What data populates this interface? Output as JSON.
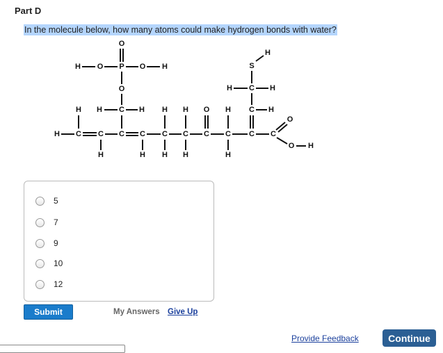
{
  "part_title": "Part D",
  "question": "In the molecule below, how many atoms could make hydrogen bonds with water?",
  "options": [
    "5",
    "7",
    "9",
    "10",
    "12"
  ],
  "buttons": {
    "submit": "Submit",
    "my_answers": "My Answers",
    "give_up": "Give Up",
    "provide_feedback": "Provide Feedback",
    "continue": "Continue"
  },
  "colors": {
    "submit": "#1a7ccb",
    "continue": "#2b5f94",
    "link": "#1a3f9c",
    "highlight": "#b4d5fd"
  }
}
